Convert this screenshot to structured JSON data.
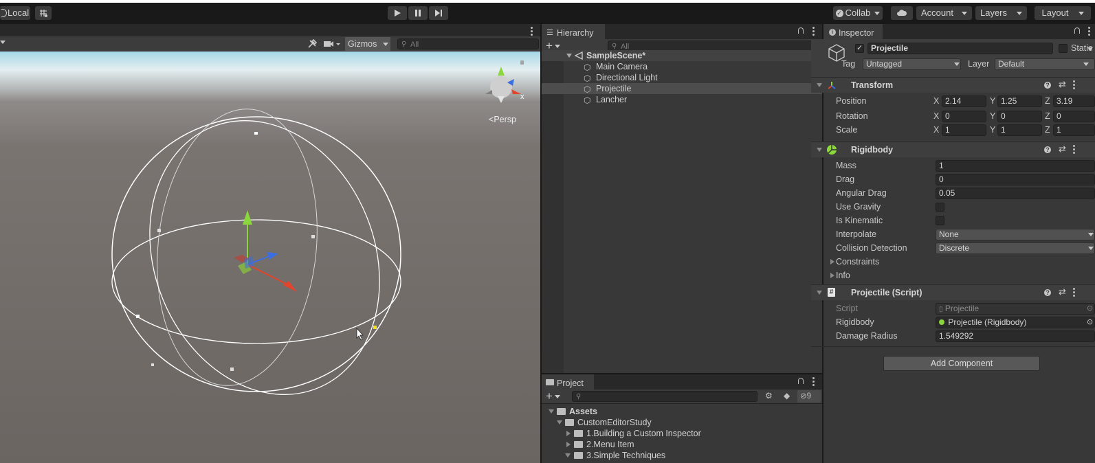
{
  "toolbar": {
    "pivot_label": "Local",
    "collab_label": "Collab",
    "account_label": "Account",
    "layers_label": "Layers",
    "layout_label": "Layout"
  },
  "scene_view": {
    "gizmos_label": "Gizmos",
    "search_placeholder": "All",
    "persp_label": "Persp",
    "axis_x_label": "x",
    "colors": {
      "sky": "#b9dde8",
      "ground": "#6f6965",
      "y_axis": "#8cd63d",
      "x_axis": "#e2442c",
      "z_axis": "#3b6ee0"
    }
  },
  "hierarchy": {
    "tab_label": "Hierarchy",
    "search_placeholder": "All",
    "scene_name": "SampleScene*",
    "items": [
      {
        "label": "Main Camera"
      },
      {
        "label": "Directional Light"
      },
      {
        "label": "Projectile"
      },
      {
        "label": "Lancher"
      }
    ]
  },
  "project": {
    "tab_label": "Project",
    "hidden_count": "9",
    "tree": [
      {
        "label": "Assets",
        "depth": 0,
        "expanded": true
      },
      {
        "label": "CustomEditorStudy",
        "depth": 1,
        "expanded": true
      },
      {
        "label": "1.Building a Custom Inspector",
        "depth": 2,
        "expanded": false
      },
      {
        "label": "2.Menu Item",
        "depth": 2,
        "expanded": false
      },
      {
        "label": "3.Simple Techniques",
        "depth": 2,
        "expanded": true
      }
    ]
  },
  "inspector": {
    "tab_label": "Inspector",
    "object_name": "Projectile",
    "static_label": "Static",
    "tag_label": "Tag",
    "tag_value": "Untagged",
    "layer_label": "Layer",
    "layer_value": "Default",
    "transform": {
      "title": "Transform",
      "position_label": "Position",
      "rotation_label": "Rotation",
      "scale_label": "Scale",
      "axis_x": "X",
      "axis_y": "Y",
      "axis_z": "Z",
      "position": {
        "x": "2.14",
        "y": "1.25",
        "z": "3.19"
      },
      "rotation": {
        "x": "0",
        "y": "0",
        "z": "0"
      },
      "scale": {
        "x": "1",
        "y": "1",
        "z": "1"
      }
    },
    "rigidbody": {
      "title": "Rigidbody",
      "mass_label": "Mass",
      "mass_value": "1",
      "drag_label": "Drag",
      "drag_value": "0",
      "angular_drag_label": "Angular Drag",
      "angular_drag_value": "0.05",
      "use_gravity_label": "Use Gravity",
      "use_gravity": false,
      "is_kinematic_label": "Is Kinematic",
      "is_kinematic": false,
      "interpolate_label": "Interpolate",
      "interpolate_value": "None",
      "collision_label": "Collision Detection",
      "collision_value": "Discrete",
      "constraints_label": "Constraints",
      "info_label": "Info"
    },
    "script": {
      "title": "Projectile (Script)",
      "script_label": "Script",
      "script_value": "Projectile",
      "rigidbody_label": "Rigidbody",
      "rigidbody_value": "Projectile (Rigidbody)",
      "damage_label": "Damage Radius",
      "damage_value": "1.549292"
    },
    "add_component_label": "Add Component"
  }
}
